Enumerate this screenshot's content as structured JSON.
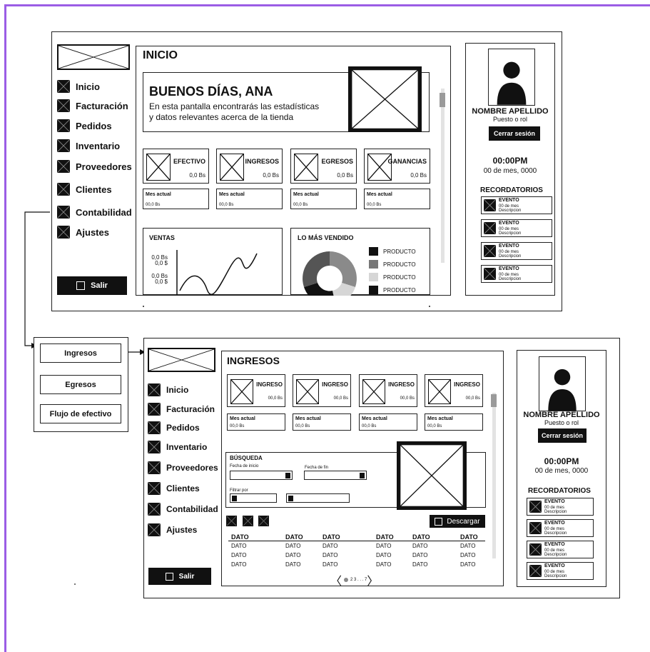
{
  "top": {
    "page_title": "INICIO",
    "nav": [
      "Inicio",
      "Facturación",
      "Pedidos",
      "Inventario",
      "Proveedores",
      "Clientes",
      "Contabilidad",
      "Ajustes"
    ],
    "logout": "Salir",
    "greeting": "BUENOS DÍAS, ANA",
    "greeting_line1": "En esta pantalla encontrarás las estadísticas",
    "greeting_line2": "y datos relevantes acerca de la tienda",
    "stats": [
      {
        "title": "EFECTIVO",
        "value": "0,0 Bs"
      },
      {
        "title": "INGRESOS",
        "value": "0,0 Bs"
      },
      {
        "title": "EGRESOS",
        "value": "0,0 Bs"
      },
      {
        "title": "GANANCIAS",
        "value": "0,0 Bs"
      }
    ],
    "month_label": "Mes actual",
    "month_value": "00,0 Bs",
    "sales": {
      "title": "VENTAS",
      "y1a": "0,0 Bs",
      "y1b": "0,0 $",
      "y2a": "0,0 Bs",
      "y2b": "0,0 $"
    },
    "best": {
      "title": "LO MÁS VENDIDO",
      "items": [
        "PRODUCTO",
        "PRODUCTO",
        "PRODUCTO",
        "PRODUCTO"
      ]
    }
  },
  "profile": {
    "name": "NOMBRE APELLIDO",
    "role": "Puesto o rol",
    "logout": "Cerrar sesión",
    "time": "00:00PM",
    "date": "00 de mes, 0000",
    "reminders_title": "RECORDATORIOS",
    "event_title": "EVENTO",
    "event_date": "00 de mes",
    "event_desc": "Descripcion"
  },
  "submenu": [
    "Ingresos",
    "Egresos",
    "Flujo de efectivo"
  ],
  "bottom": {
    "page_title": "INGRESOS",
    "card_title": "INGRESO",
    "card_value": "00,0 Bs",
    "month_label": "Mes actual",
    "month_value": "00,0 Bs",
    "search": "BÚSQUEDA",
    "from": "Fecha de inicio",
    "to": "Fecha de fin",
    "filter": "Filtrar por",
    "download": "Descargar",
    "header": "DATO",
    "cell": "DATO",
    "pager": "2 3 . . . 7"
  },
  "colors": {
    "accent": "#9b5de5",
    "ink": "#111111"
  }
}
